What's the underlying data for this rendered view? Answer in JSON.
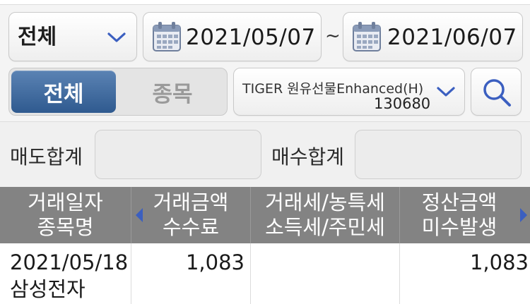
{
  "filter": {
    "category": "전체",
    "date_from": "2021/05/07",
    "date_sep": "~",
    "date_to": "2021/06/07"
  },
  "segment": {
    "all": "전체",
    "stock": "종목",
    "active": "all"
  },
  "stock_select": {
    "name": "TIGER 원유선물Enhanced(H)",
    "code": "130680"
  },
  "summary": {
    "sell_label": "매도합계",
    "sell_value": "",
    "buy_label": "매수합계",
    "buy_value": ""
  },
  "table": {
    "headers": [
      {
        "line1": "거래일자",
        "line2": "종목명"
      },
      {
        "line1": "거래금액",
        "line2": "수수료"
      },
      {
        "line1": "거래세/농특세",
        "line2": "소득세/주민세"
      },
      {
        "line1": "정산금액",
        "line2": "미수발생"
      }
    ],
    "rows": [
      {
        "date": "2021/05/18",
        "name": "삼성전자",
        "amount": "1,083",
        "tax": "",
        "settlement": "1,083"
      }
    ]
  },
  "colors": {
    "accent": "#3a659b",
    "header_bg": "#838383",
    "arrow": "#3b5fc0"
  }
}
